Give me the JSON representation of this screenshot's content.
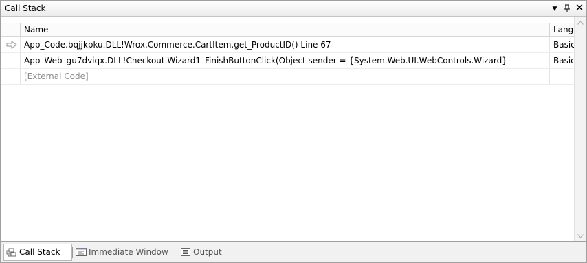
{
  "window": {
    "title": "Call Stack",
    "dropdown_icon": "▼",
    "pin_icon": "ꟷ",
    "close_icon": "✕"
  },
  "columns": {
    "name": "Name",
    "language": "Langu"
  },
  "rows": [
    {
      "name": "App_Code.bqjjkpku.DLL!Wrox.Commerce.CartItem.get_ProductID() Line 67",
      "language": "Basic",
      "current": true
    },
    {
      "name": "App_Web_gu7dviqx.DLL!Checkout.Wizard1_FinishButtonClick(Object sender = {System.Web.UI.WebControls.Wizard}",
      "language": "Basic",
      "current": false
    },
    {
      "name": "[External Code]",
      "language": "",
      "current": false
    }
  ],
  "tabs": [
    {
      "label": "Call Stack",
      "icon": "call-stack-icon",
      "active": true
    },
    {
      "label": "Immediate Window",
      "icon": "immediate-window-icon",
      "active": false
    },
    {
      "label": "Output",
      "icon": "output-icon",
      "active": false
    }
  ]
}
